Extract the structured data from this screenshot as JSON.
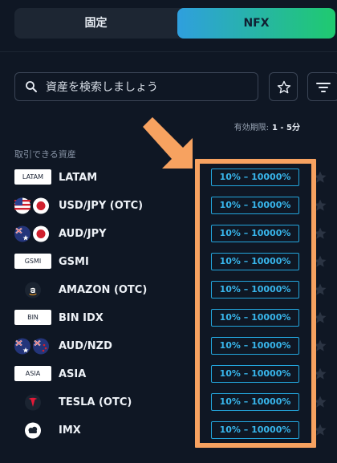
{
  "toggle": {
    "fixed_label": "固定",
    "nfx_label": "NFX"
  },
  "search": {
    "placeholder": "資産を検索しましょう"
  },
  "expiry": {
    "label": "有効期限:",
    "value": "1 - 5分"
  },
  "section_label": "取引できる資産",
  "assets": [
    {
      "name": "LATAM",
      "icon": "chip",
      "chip_text": "LATAM",
      "payout": "10% – 10000%"
    },
    {
      "name": "USD/JPY (OTC)",
      "icon": "flags-us-jp",
      "payout": "10% – 10000%"
    },
    {
      "name": "AUD/JPY",
      "icon": "flags-au-jp",
      "payout": "10% – 10000%"
    },
    {
      "name": "GSMI",
      "icon": "chip",
      "chip_text": "GSMI",
      "payout": "10% – 10000%"
    },
    {
      "name": "AMAZON (OTC)",
      "icon": "amazon-logo-icon",
      "payout": "10% – 10000%"
    },
    {
      "name": "BIN IDX",
      "icon": "chip",
      "chip_text": "BIN",
      "payout": "10% – 10000%"
    },
    {
      "name": "AUD/NZD",
      "icon": "flags-au-nz",
      "payout": "10% – 10000%"
    },
    {
      "name": "ASIA",
      "icon": "chip",
      "chip_text": "ASIA",
      "payout": "10% – 10000%"
    },
    {
      "name": "TESLA (OTC)",
      "icon": "tesla-logo-icon",
      "payout": "10% – 10000%"
    },
    {
      "name": "IMX",
      "icon": "imx-logo-icon",
      "payout": "10% – 10000%"
    }
  ],
  "colors": {
    "background": "#0f1724",
    "payout_accent": "#38b6ec",
    "highlight": "#f7a260",
    "nfx_gradient_start": "#2f9fde",
    "nfx_gradient_end": "#1fca6f"
  }
}
